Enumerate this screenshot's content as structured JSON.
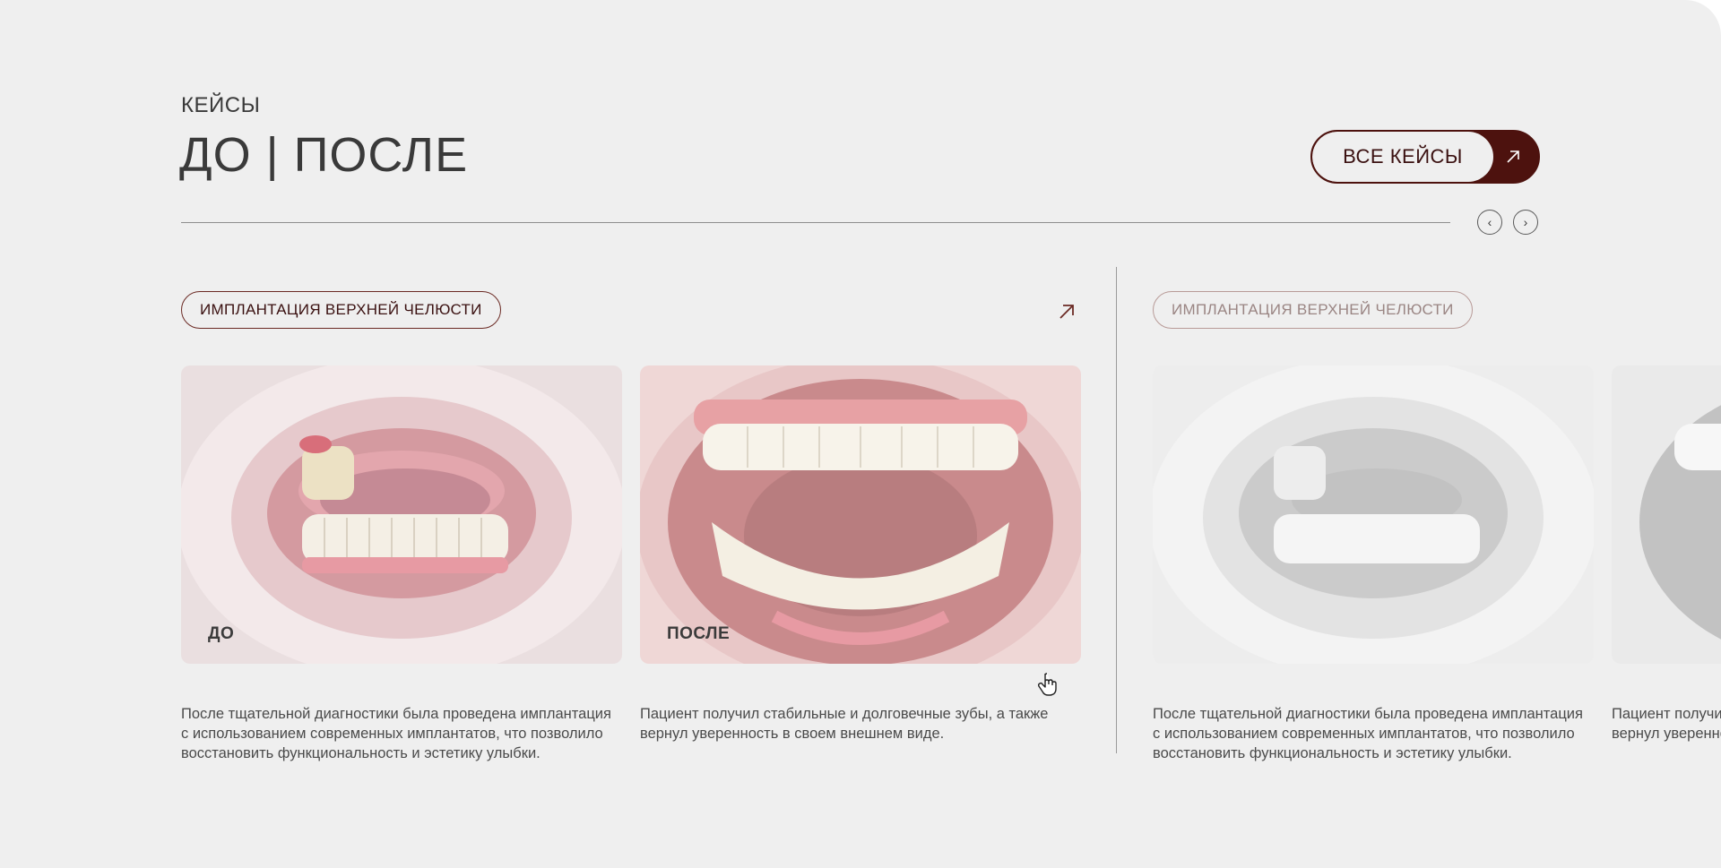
{
  "section": {
    "eyebrow": "КЕЙСЫ",
    "title": "ДО | ПОСЛЕ",
    "all_cases_label": "ВСЕ КЕЙСЫ",
    "prev_label": "‹",
    "next_label": "›"
  },
  "cases": [
    {
      "tag": "ИМПЛАНТАЦИЯ ВЕРХНЕЙ ЧЕЛЮСТИ",
      "before_label": "ДО",
      "after_label": "ПОСЛЕ",
      "before_text": "После тщательной диагностики была проведена имплантация с использованием современных имплантатов, что позволило восстановить функциональность и эстетику улыбки.",
      "after_text": "Пациент получил стабильные и долговечные зубы, а также вернул уверенность в своем внешнем виде."
    },
    {
      "tag": "ИМПЛАНТАЦИЯ ВЕРХНЕЙ ЧЕЛЮСТИ",
      "before_text": "После тщательной диагностики была проведена имплантация с использованием современных имплантатов, что позволило восстановить функциональность и эстетику улыбки.",
      "after_text": "Пациент получил стабильные и долговечные зубы, а также вернул уверенность в своем внешнем виде."
    }
  ],
  "colors": {
    "background": "#efefef",
    "accent": "#4d120e",
    "text": "#3a3a3a"
  },
  "icons": [
    "arrow-up-right-icon",
    "chevron-left-icon",
    "chevron-right-icon",
    "hand-cursor-icon"
  ]
}
